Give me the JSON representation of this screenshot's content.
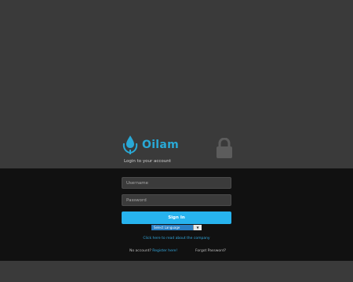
{
  "brand": {
    "name": "Oilam",
    "logo_icon": "oil-drop-icon",
    "accent_color": "#29a9d6"
  },
  "login": {
    "subtitle": "Login to your account",
    "lock_icon": "lock-icon",
    "username_placeholder": "Username",
    "password_placeholder": "Password",
    "signin_label": "Sign In"
  },
  "language": {
    "selected": "Select Language",
    "caret": "▼"
  },
  "links": {
    "company": "Click here to read about the company",
    "no_account_text": "No account? ",
    "register": "Register here!",
    "forgot": "Forgot Password?"
  }
}
